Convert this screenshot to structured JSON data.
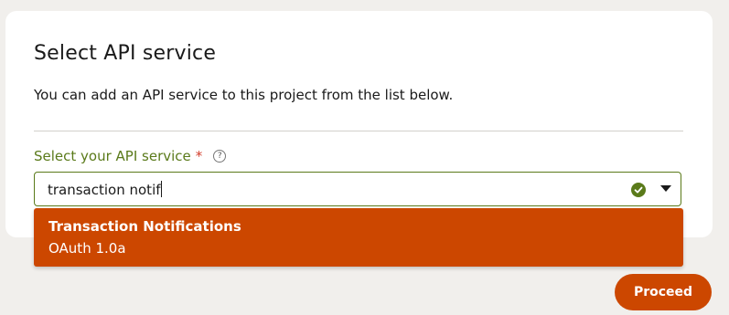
{
  "dialog": {
    "title": "Select API service",
    "subtitle": "You can add an API service to this project from the list below."
  },
  "field": {
    "label": "Select your API service",
    "required_mark": "*",
    "help_icon": "help-circle-icon",
    "value": "transaction notif",
    "status_icon": "check-circle-icon",
    "toggle_icon": "chevron-down-icon"
  },
  "dropdown": {
    "options": [
      {
        "name": "Transaction Notifications",
        "auth": "OAuth 1.0a"
      }
    ]
  },
  "actions": {
    "proceed_label": "Proceed"
  },
  "colors": {
    "accent": "#cc4700",
    "label_green": "#5a7a1a",
    "required_red": "#d23c2a",
    "background": "#f1efec"
  }
}
